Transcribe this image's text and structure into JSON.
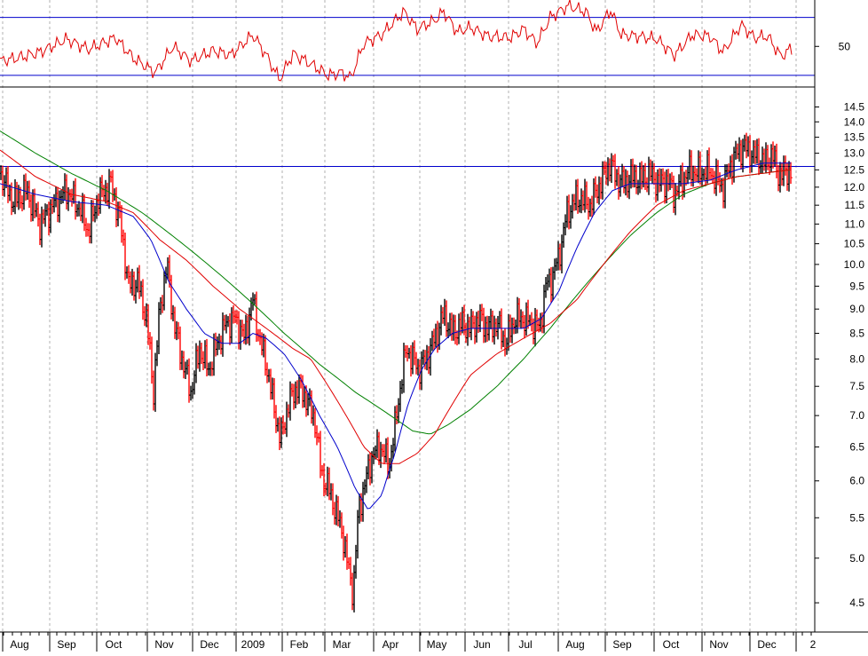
{
  "chart_data": {
    "type": "line",
    "colors": {
      "up_bar": "#000000",
      "down_bar": "#ff0000",
      "ma_fast": "#0000cc",
      "ma_mid": "#e00000",
      "ma_slow": "#008000",
      "resistance": "#0000cc",
      "rsi": "#e00000",
      "rsi_band": "#0000cc"
    },
    "price_panel": {
      "y_scale": "log",
      "ylim": [
        4.2,
        15.2
      ],
      "yticks": [
        4.5,
        5.0,
        5.5,
        6.0,
        6.5,
        7.0,
        7.5,
        8.0,
        8.5,
        9.0,
        9.5,
        10.0,
        10.5,
        11.0,
        11.5,
        12.0,
        12.5,
        13.0,
        13.5,
        14.0,
        14.5
      ],
      "ytick_labels": [
        "4.5",
        "5.0",
        "5.5",
        "6.0",
        "6.5",
        "7.0",
        "7.5",
        "8.0",
        "8.5",
        "9.0",
        "9.5",
        "10.0",
        "10.5",
        "11.0",
        "11.5",
        "12.0",
        "12.5",
        "13.0",
        "13.5",
        "14.0",
        "14.5"
      ],
      "resistance_level": 12.6,
      "price_keypoints": [
        {
          "x": 0,
          "y": 12.4
        },
        {
          "x": 15,
          "y": 11.6
        },
        {
          "x": 30,
          "y": 11.9
        },
        {
          "x": 45,
          "y": 11.0
        },
        {
          "x": 60,
          "y": 11.5
        },
        {
          "x": 75,
          "y": 11.9
        },
        {
          "x": 90,
          "y": 11.4
        },
        {
          "x": 100,
          "y": 10.8
        },
        {
          "x": 110,
          "y": 11.7
        },
        {
          "x": 125,
          "y": 12.1
        },
        {
          "x": 135,
          "y": 11.1
        },
        {
          "x": 145,
          "y": 9.5
        },
        {
          "x": 155,
          "y": 9.6
        },
        {
          "x": 165,
          "y": 8.8
        },
        {
          "x": 173,
          "y": 7.4
        },
        {
          "x": 180,
          "y": 9.0
        },
        {
          "x": 188,
          "y": 10.0
        },
        {
          "x": 196,
          "y": 8.7
        },
        {
          "x": 205,
          "y": 8.0
        },
        {
          "x": 215,
          "y": 7.4
        },
        {
          "x": 225,
          "y": 8.2
        },
        {
          "x": 235,
          "y": 7.8
        },
        {
          "x": 245,
          "y": 8.3
        },
        {
          "x": 255,
          "y": 8.7
        },
        {
          "x": 265,
          "y": 8.8
        },
        {
          "x": 275,
          "y": 8.4
        },
        {
          "x": 285,
          "y": 9.2
        },
        {
          "x": 292,
          "y": 8.4
        },
        {
          "x": 300,
          "y": 7.9
        },
        {
          "x": 308,
          "y": 7.2
        },
        {
          "x": 316,
          "y": 6.6
        },
        {
          "x": 325,
          "y": 7.2
        },
        {
          "x": 335,
          "y": 7.5
        },
        {
          "x": 345,
          "y": 7.3
        },
        {
          "x": 355,
          "y": 6.9
        },
        {
          "x": 362,
          "y": 6.1
        },
        {
          "x": 370,
          "y": 5.9
        },
        {
          "x": 378,
          "y": 5.6
        },
        {
          "x": 386,
          "y": 5.3
        },
        {
          "x": 392,
          "y": 4.9
        },
        {
          "x": 398,
          "y": 4.6
        },
        {
          "x": 404,
          "y": 5.6
        },
        {
          "x": 412,
          "y": 6.0
        },
        {
          "x": 420,
          "y": 6.4
        },
        {
          "x": 430,
          "y": 6.5
        },
        {
          "x": 438,
          "y": 6.2
        },
        {
          "x": 445,
          "y": 6.8
        },
        {
          "x": 452,
          "y": 7.6
        },
        {
          "x": 458,
          "y": 8.2
        },
        {
          "x": 465,
          "y": 8.0
        },
        {
          "x": 472,
          "y": 7.8
        },
        {
          "x": 480,
          "y": 8.0
        },
        {
          "x": 490,
          "y": 8.4
        },
        {
          "x": 500,
          "y": 8.9
        },
        {
          "x": 510,
          "y": 8.5
        },
        {
          "x": 520,
          "y": 8.7
        },
        {
          "x": 530,
          "y": 8.6
        },
        {
          "x": 540,
          "y": 8.8
        },
        {
          "x": 550,
          "y": 8.6
        },
        {
          "x": 560,
          "y": 8.7
        },
        {
          "x": 570,
          "y": 8.3
        },
        {
          "x": 580,
          "y": 8.8
        },
        {
          "x": 590,
          "y": 8.8
        },
        {
          "x": 600,
          "y": 8.7
        },
        {
          "x": 608,
          "y": 8.6
        },
        {
          "x": 615,
          "y": 9.5
        },
        {
          "x": 622,
          "y": 9.7
        },
        {
          "x": 630,
          "y": 10.2
        },
        {
          "x": 638,
          "y": 11.2
        },
        {
          "x": 646,
          "y": 11.6
        },
        {
          "x": 655,
          "y": 11.7
        },
        {
          "x": 665,
          "y": 11.5
        },
        {
          "x": 672,
          "y": 11.9
        },
        {
          "x": 680,
          "y": 12.3
        },
        {
          "x": 687,
          "y": 12.7
        },
        {
          "x": 694,
          "y": 12.3
        },
        {
          "x": 702,
          "y": 12.1
        },
        {
          "x": 712,
          "y": 12.3
        },
        {
          "x": 722,
          "y": 12.2
        },
        {
          "x": 732,
          "y": 12.4
        },
        {
          "x": 742,
          "y": 12.1
        },
        {
          "x": 752,
          "y": 12.2
        },
        {
          "x": 760,
          "y": 11.8
        },
        {
          "x": 768,
          "y": 12.2
        },
        {
          "x": 778,
          "y": 12.5
        },
        {
          "x": 788,
          "y": 12.4
        },
        {
          "x": 798,
          "y": 12.5
        },
        {
          "x": 808,
          "y": 12.2
        },
        {
          "x": 815,
          "y": 12.0
        },
        {
          "x": 822,
          "y": 12.6
        },
        {
          "x": 830,
          "y": 13.0
        },
        {
          "x": 838,
          "y": 13.2
        },
        {
          "x": 846,
          "y": 13.0
        },
        {
          "x": 854,
          "y": 12.9
        },
        {
          "x": 862,
          "y": 12.7
        },
        {
          "x": 870,
          "y": 13.0
        },
        {
          "x": 876,
          "y": 12.4
        },
        {
          "x": 884,
          "y": 12.4
        },
        {
          "x": 892,
          "y": 12.5
        }
      ],
      "ma_fast": [
        {
          "x": 0,
          "y": 12.1
        },
        {
          "x": 40,
          "y": 11.8
        },
        {
          "x": 80,
          "y": 11.6
        },
        {
          "x": 120,
          "y": 11.5
        },
        {
          "x": 150,
          "y": 11.2
        },
        {
          "x": 170,
          "y": 10.6
        },
        {
          "x": 190,
          "y": 9.6
        },
        {
          "x": 210,
          "y": 9.0
        },
        {
          "x": 230,
          "y": 8.5
        },
        {
          "x": 250,
          "y": 8.3
        },
        {
          "x": 270,
          "y": 8.3
        },
        {
          "x": 285,
          "y": 8.5
        },
        {
          "x": 300,
          "y": 8.4
        },
        {
          "x": 320,
          "y": 8.1
        },
        {
          "x": 340,
          "y": 7.6
        },
        {
          "x": 360,
          "y": 7.0
        },
        {
          "x": 380,
          "y": 6.5
        },
        {
          "x": 400,
          "y": 5.9
        },
        {
          "x": 415,
          "y": 5.6
        },
        {
          "x": 430,
          "y": 5.8
        },
        {
          "x": 445,
          "y": 6.4
        },
        {
          "x": 460,
          "y": 7.2
        },
        {
          "x": 475,
          "y": 7.8
        },
        {
          "x": 490,
          "y": 8.2
        },
        {
          "x": 510,
          "y": 8.5
        },
        {
          "x": 530,
          "y": 8.6
        },
        {
          "x": 560,
          "y": 8.6
        },
        {
          "x": 590,
          "y": 8.6
        },
        {
          "x": 610,
          "y": 8.8
        },
        {
          "x": 630,
          "y": 9.4
        },
        {
          "x": 650,
          "y": 10.4
        },
        {
          "x": 670,
          "y": 11.3
        },
        {
          "x": 690,
          "y": 11.9
        },
        {
          "x": 710,
          "y": 12.1
        },
        {
          "x": 740,
          "y": 12.1
        },
        {
          "x": 770,
          "y": 12.1
        },
        {
          "x": 800,
          "y": 12.2
        },
        {
          "x": 830,
          "y": 12.5
        },
        {
          "x": 860,
          "y": 12.7
        },
        {
          "x": 890,
          "y": 12.7
        }
      ],
      "ma_mid": [
        {
          "x": 0,
          "y": 13.1
        },
        {
          "x": 40,
          "y": 12.3
        },
        {
          "x": 80,
          "y": 11.8
        },
        {
          "x": 120,
          "y": 11.6
        },
        {
          "x": 150,
          "y": 11.3
        },
        {
          "x": 180,
          "y": 10.6
        },
        {
          "x": 210,
          "y": 10.1
        },
        {
          "x": 240,
          "y": 9.5
        },
        {
          "x": 270,
          "y": 9.0
        },
        {
          "x": 300,
          "y": 8.6
        },
        {
          "x": 330,
          "y": 8.2
        },
        {
          "x": 350,
          "y": 8.0
        },
        {
          "x": 370,
          "y": 7.5
        },
        {
          "x": 390,
          "y": 7.0
        },
        {
          "x": 410,
          "y": 6.5
        },
        {
          "x": 430,
          "y": 6.25
        },
        {
          "x": 450,
          "y": 6.25
        },
        {
          "x": 470,
          "y": 6.4
        },
        {
          "x": 490,
          "y": 6.7
        },
        {
          "x": 510,
          "y": 7.2
        },
        {
          "x": 530,
          "y": 7.7
        },
        {
          "x": 560,
          "y": 8.1
        },
        {
          "x": 590,
          "y": 8.4
        },
        {
          "x": 620,
          "y": 8.7
        },
        {
          "x": 650,
          "y": 9.2
        },
        {
          "x": 680,
          "y": 10.0
        },
        {
          "x": 710,
          "y": 10.8
        },
        {
          "x": 740,
          "y": 11.5
        },
        {
          "x": 770,
          "y": 11.9
        },
        {
          "x": 800,
          "y": 12.1
        },
        {
          "x": 830,
          "y": 12.3
        },
        {
          "x": 860,
          "y": 12.4
        },
        {
          "x": 890,
          "y": 12.5
        }
      ],
      "ma_slow": [
        {
          "x": 0,
          "y": 13.7
        },
        {
          "x": 40,
          "y": 13.0
        },
        {
          "x": 80,
          "y": 12.4
        },
        {
          "x": 120,
          "y": 11.9
        },
        {
          "x": 160,
          "y": 11.3
        },
        {
          "x": 200,
          "y": 10.6
        },
        {
          "x": 240,
          "y": 9.9
        },
        {
          "x": 280,
          "y": 9.2
        },
        {
          "x": 320,
          "y": 8.5
        },
        {
          "x": 360,
          "y": 7.9
        },
        {
          "x": 400,
          "y": 7.4
        },
        {
          "x": 440,
          "y": 7.0
        },
        {
          "x": 465,
          "y": 6.75
        },
        {
          "x": 485,
          "y": 6.7
        },
        {
          "x": 505,
          "y": 6.85
        },
        {
          "x": 530,
          "y": 7.1
        },
        {
          "x": 560,
          "y": 7.5
        },
        {
          "x": 590,
          "y": 8.0
        },
        {
          "x": 620,
          "y": 8.6
        },
        {
          "x": 650,
          "y": 9.3
        },
        {
          "x": 680,
          "y": 10.0
        },
        {
          "x": 710,
          "y": 10.7
        },
        {
          "x": 740,
          "y": 11.3
        },
        {
          "x": 770,
          "y": 11.8
        },
        {
          "x": 800,
          "y": 12.1
        },
        {
          "x": 830,
          "y": 12.3
        },
        {
          "x": 860,
          "y": 12.4
        },
        {
          "x": 890,
          "y": 12.5
        }
      ]
    },
    "rsi_panel": {
      "ylim": [
        22,
        82
      ],
      "upper_band": 70,
      "lower_band": 30,
      "yticks": [
        50
      ],
      "ytick_labels": [
        "50"
      ],
      "rsi_keypoints": [
        {
          "x": 0,
          "y": 40
        },
        {
          "x": 20,
          "y": 42
        },
        {
          "x": 45,
          "y": 46
        },
        {
          "x": 75,
          "y": 55
        },
        {
          "x": 100,
          "y": 48
        },
        {
          "x": 130,
          "y": 56
        },
        {
          "x": 150,
          "y": 42
        },
        {
          "x": 175,
          "y": 32
        },
        {
          "x": 195,
          "y": 50
        },
        {
          "x": 215,
          "y": 40
        },
        {
          "x": 240,
          "y": 47
        },
        {
          "x": 260,
          "y": 44
        },
        {
          "x": 285,
          "y": 58
        },
        {
          "x": 300,
          "y": 44
        },
        {
          "x": 315,
          "y": 27
        },
        {
          "x": 330,
          "y": 45
        },
        {
          "x": 350,
          "y": 38
        },
        {
          "x": 370,
          "y": 30
        },
        {
          "x": 385,
          "y": 32
        },
        {
          "x": 395,
          "y": 28
        },
        {
          "x": 410,
          "y": 52
        },
        {
          "x": 430,
          "y": 58
        },
        {
          "x": 455,
          "y": 74
        },
        {
          "x": 470,
          "y": 62
        },
        {
          "x": 490,
          "y": 68
        },
        {
          "x": 500,
          "y": 74
        },
        {
          "x": 515,
          "y": 60
        },
        {
          "x": 530,
          "y": 63
        },
        {
          "x": 550,
          "y": 57
        },
        {
          "x": 575,
          "y": 56
        },
        {
          "x": 590,
          "y": 62
        },
        {
          "x": 605,
          "y": 52
        },
        {
          "x": 620,
          "y": 70
        },
        {
          "x": 640,
          "y": 78
        },
        {
          "x": 660,
          "y": 74
        },
        {
          "x": 672,
          "y": 60
        },
        {
          "x": 688,
          "y": 75
        },
        {
          "x": 700,
          "y": 58
        },
        {
          "x": 720,
          "y": 57
        },
        {
          "x": 740,
          "y": 55
        },
        {
          "x": 760,
          "y": 44
        },
        {
          "x": 780,
          "y": 58
        },
        {
          "x": 800,
          "y": 57
        },
        {
          "x": 815,
          "y": 46
        },
        {
          "x": 835,
          "y": 65
        },
        {
          "x": 850,
          "y": 56
        },
        {
          "x": 865,
          "y": 57
        },
        {
          "x": 880,
          "y": 43
        },
        {
          "x": 890,
          "y": 48
        }
      ]
    },
    "x_axis": {
      "labels": [
        "Aug",
        "Sep",
        "Oct",
        "Nov",
        "Dec",
        "2009",
        "Feb",
        "Mar",
        "Apr",
        "May",
        "Jun",
        "Jul",
        "Aug",
        "Sep",
        "Oct",
        "Nov",
        "Dec",
        "2"
      ],
      "label_x": [
        22,
        75,
        128,
        185,
        236,
        285,
        337,
        385,
        440,
        492,
        543,
        592,
        648,
        701,
        756,
        810,
        864,
        916
      ]
    }
  }
}
